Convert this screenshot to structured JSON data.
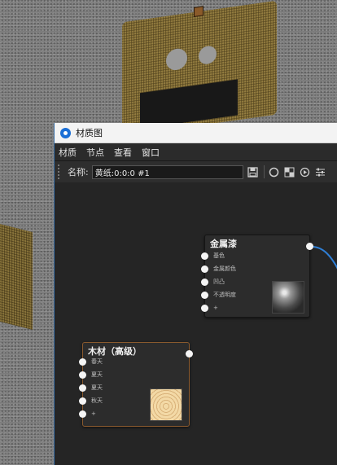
{
  "window": {
    "title": "材质图"
  },
  "menu": [
    "材质",
    "节点",
    "查看",
    "窗口"
  ],
  "toolbar": {
    "name_label": "名称:",
    "name_value": "黄纸:0:0:0 #1"
  },
  "nodes": {
    "metal": {
      "title": "金属漆",
      "ports": [
        "基色",
        "金属颜色",
        "凹凸",
        "不透明度",
        "+"
      ]
    },
    "wood": {
      "title": "木材（高级）",
      "ports": [
        "春天",
        "夏天",
        "夏天",
        "秋天",
        "+"
      ]
    }
  },
  "colors": {
    "wire": "#2f7fd6",
    "wood_border": "#8a5a2e",
    "title_accent": "#1b6fd6"
  }
}
